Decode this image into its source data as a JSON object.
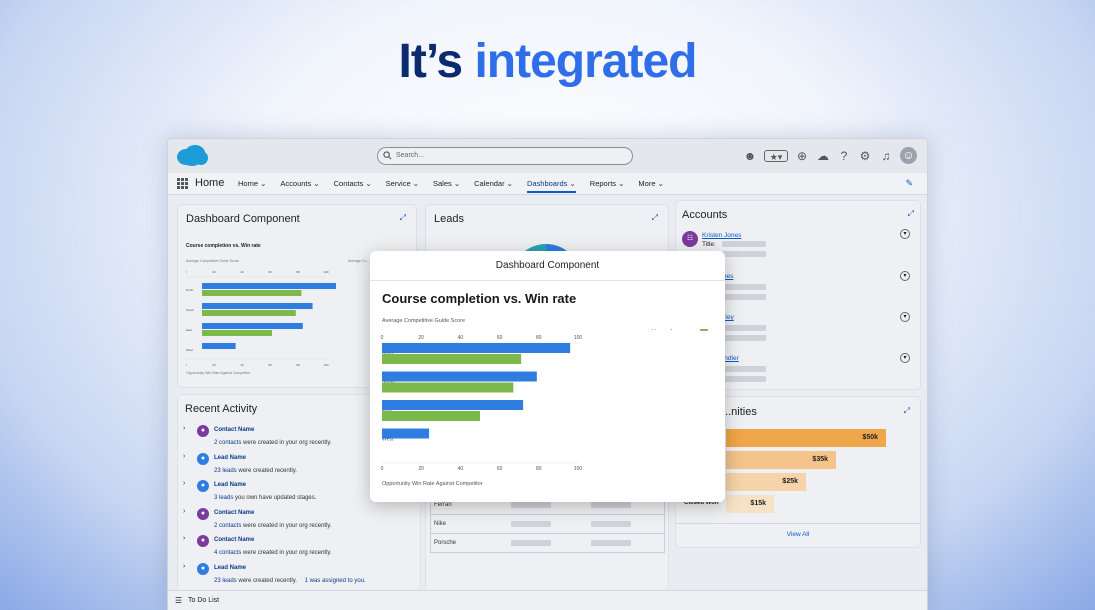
{
  "hero": {
    "part1": "It’s",
    "part2": "integrated"
  },
  "search": {
    "placeholder": "Search..."
  },
  "nav": {
    "home": "Home",
    "items": [
      "Home",
      "Accounts",
      "Contacts",
      "Service",
      "Sales",
      "Calendar",
      "Dashboards",
      "Reports",
      "More"
    ],
    "active": "Dashboards"
  },
  "dashboard_card": {
    "title": "Dashboard Component",
    "chart_title": "Course completion vs. Win rate",
    "axis_top": "Average Competitive Guide Score",
    "axis_bottom": "Opportunity Win Rate Against Competitor",
    "legend_short": "Average Co..."
  },
  "leads_card": {
    "title": "Leads"
  },
  "accounts_card": {
    "title": "Accounts",
    "rows": [
      {
        "name": "Kristen Jones",
        "label": "Title:"
      },
      {
        "name": "Jones"
      },
      {
        "name": "Bailey"
      },
      {
        "name": "Handler"
      }
    ]
  },
  "activity": {
    "title": "Recent Activity",
    "items": [
      {
        "title": "Contact Name",
        "count": "2 contacts",
        "text": "were created in your org recently.",
        "extra": ""
      },
      {
        "title": "Lead Name",
        "count": "23 leads",
        "text": "were created recently.",
        "extra": ""
      },
      {
        "title": "Lead Name",
        "count": "3 leads",
        "text": "you own have updated stages.",
        "extra": ""
      },
      {
        "title": "Contact Name",
        "count": "2 contacts",
        "text": "were created in your org recently.",
        "extra": ""
      },
      {
        "title": "Contact Name",
        "count": "4 contacts",
        "text": "were created in your org recently.",
        "extra": ""
      },
      {
        "title": "Lead Name",
        "count": "23 leads",
        "text": "were created recently.",
        "extra": "1 was assigned to you."
      }
    ]
  },
  "opps": {
    "title": "...nities",
    "stages": [
      {
        "label": "",
        "value": "$50k"
      },
      {
        "label": "",
        "value": "$35k"
      },
      {
        "label": "",
        "value": "$25k"
      },
      {
        "label": "Closed Won",
        "value": "$15k"
      }
    ],
    "view_all": "View All"
  },
  "table": {
    "rows": [
      "Ferrari",
      "Nike",
      "Porsche"
    ]
  },
  "bottom": {
    "todo": "To Do List"
  },
  "modal": {
    "header": "Dashboard Component",
    "title": "Course completion vs. Win rate",
    "axis_top": "Average Competitive Guide Score",
    "axis_bottom": "Opportunity Win Rate Against Competitor"
  },
  "chart_data": {
    "type": "bar",
    "orientation": "horizontal",
    "categories": [
      "North",
      "South",
      "East",
      "West"
    ],
    "series": [
      {
        "name": "Average Competitive Guide Score",
        "color": "#2f7de1",
        "values": [
          96,
          79,
          72,
          24
        ]
      },
      {
        "name": "Opportunity Win Rate",
        "color": "#7cb84a",
        "values": [
          71,
          67,
          50,
          0
        ]
      }
    ],
    "xlim": [
      0,
      100
    ],
    "ticks": [
      "0",
      "20",
      "40",
      "60",
      "80",
      "100"
    ],
    "xlabel_top": "Average Competitive Guide Score",
    "xlabel_bottom": "Opportunity Win Rate Against Competitor",
    "legend": "top-right"
  },
  "colors": {
    "accent": "#2f6ee8",
    "hero_dark": "#0b2a6f",
    "bar_blue": "#2f7de1",
    "bar_green": "#7cb84a",
    "funnel": "#f1a94a"
  }
}
